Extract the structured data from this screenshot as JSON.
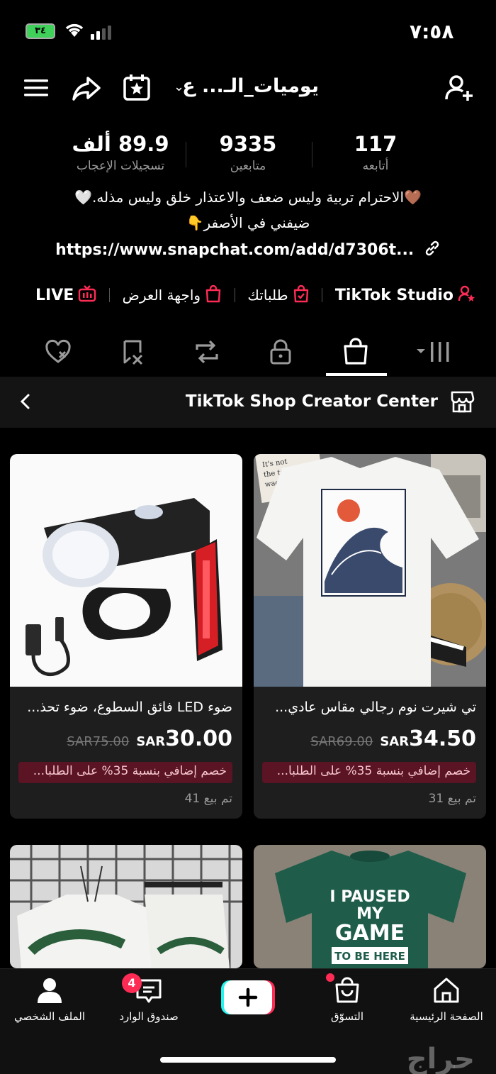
{
  "status": {
    "time": "٧:٥٨",
    "battery": "٣٤"
  },
  "header": {
    "username": "يوميات_الـ... ع"
  },
  "stats": [
    {
      "value": "117",
      "label": "أتابعه"
    },
    {
      "value": "9335",
      "label": "متابعين"
    },
    {
      "value": "89.9 ألف",
      "label": "تسجيلات الإعجاب"
    }
  ],
  "bio": {
    "line1": "🤎الاحترام تربية وليس ضعف والاعتذار خلق وليس مذله.🤍",
    "line2": "ضيفني في الأصفر👇",
    "link": "https://www.snapchat.com/add/d7306t..."
  },
  "quick_links": {
    "studio": "TikTok Studio",
    "orders": "طلباتك",
    "showcase": "واجهة العرض",
    "live": "LIVE"
  },
  "shop_bar": {
    "title": "TikTok Shop Creator Center"
  },
  "products": [
    {
      "title": "تي شيرت نوم رجالي مقاس عادي...",
      "old_price": "SAR69.00",
      "currency": "SAR",
      "price": "34.50",
      "promo": "خصم إضافي بنسبة 35% على الطلبا...",
      "sold": "تم بيع 31"
    },
    {
      "title": "ضوء LED فائق السطوع، ضوء تحذ...",
      "old_price": "SAR75.00",
      "currency": "SAR",
      "price": "30.00",
      "promo": "خصم إضافي بنسبة 35% على الطلبا...",
      "sold": "تم بيع 41"
    }
  ],
  "product_images": {
    "tshirt_print_lines": [
      "I PAUSED",
      "MY",
      "GAME",
      "TO BE HERE"
    ],
    "note_text": [
      "It's not",
      "the tail that",
      "wags the dog"
    ]
  },
  "bottom_nav": {
    "home": "الصفحة الرئيسية",
    "shop": "التسوّق",
    "inbox": "صندوق الوارد",
    "inbox_badge": "4",
    "profile": "الملف الشخصي"
  },
  "watermark": "حراج",
  "colors": {
    "accent": "#fe2c55",
    "promo_bg": "#5a1424",
    "card_bg": "#1e1e1e"
  }
}
